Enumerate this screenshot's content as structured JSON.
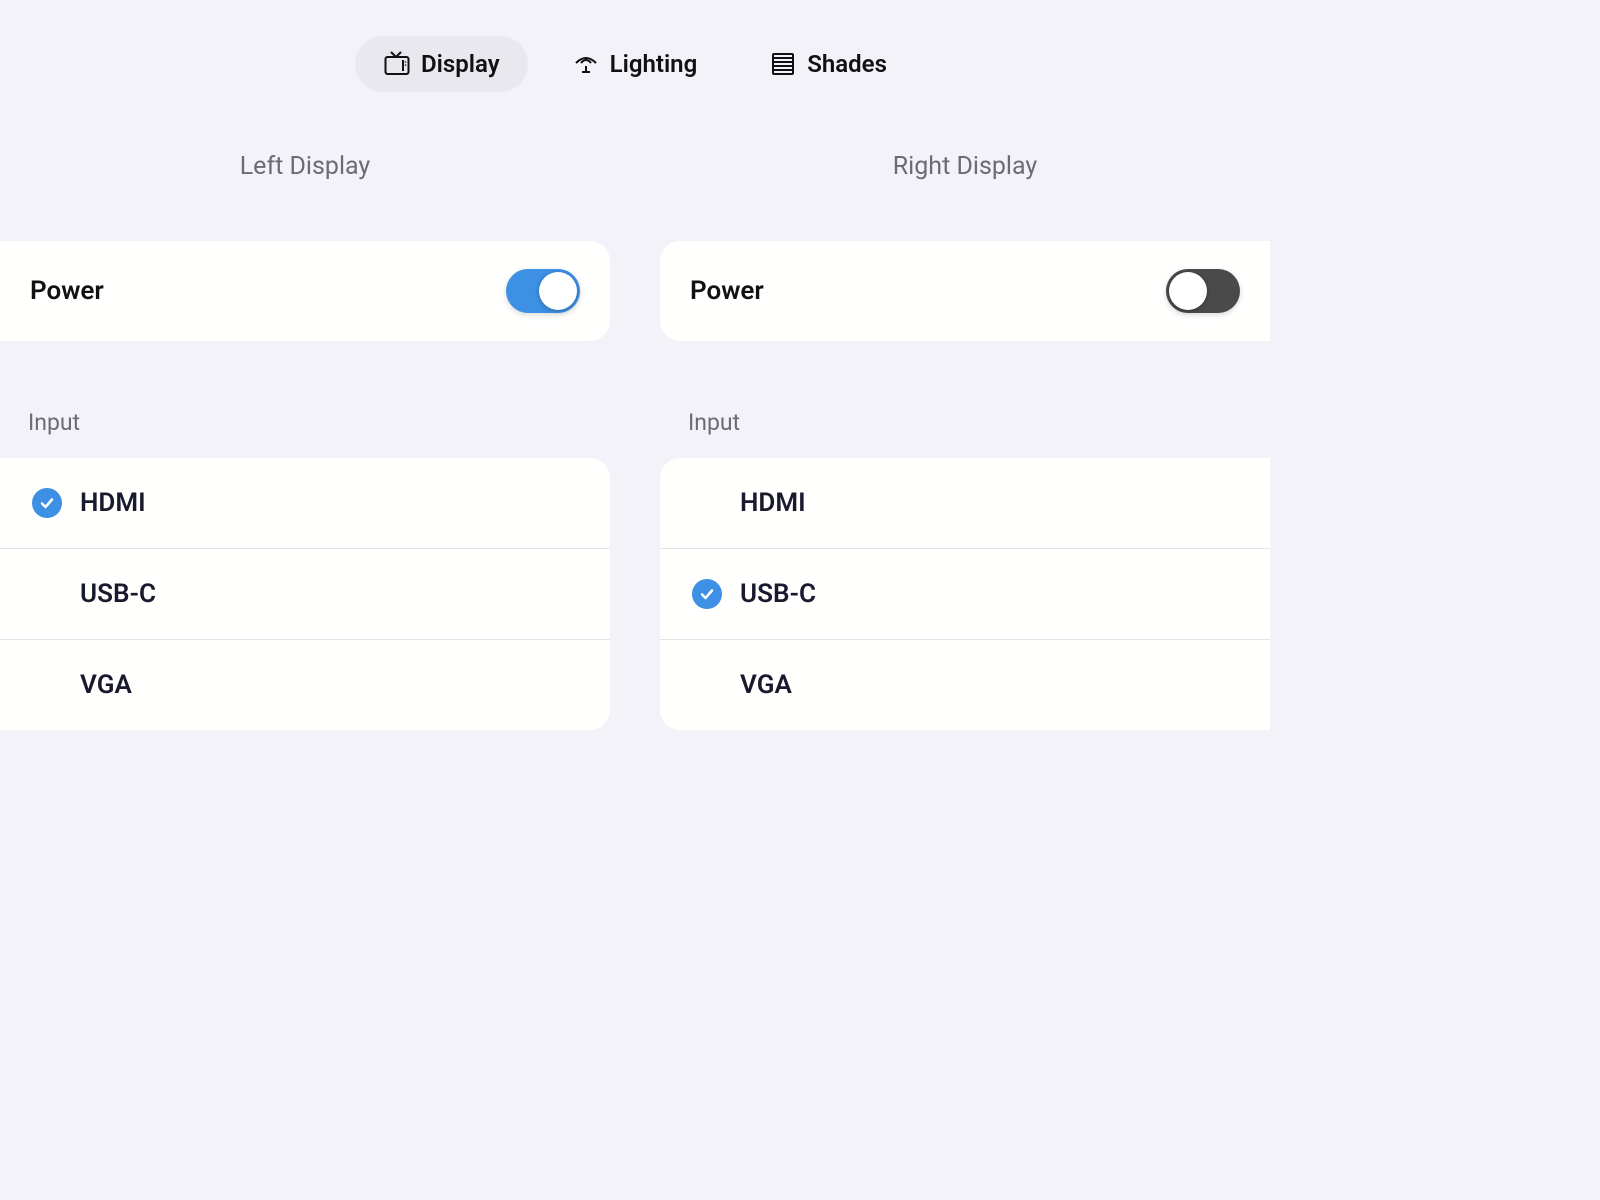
{
  "tabs": [
    {
      "label": "Display",
      "icon": "tv-icon",
      "active": true
    },
    {
      "label": "Lighting",
      "icon": "light-icon",
      "active": false
    },
    {
      "label": "Shades",
      "icon": "shades-icon",
      "active": false
    }
  ],
  "panels": {
    "left": {
      "title": "Left Display",
      "power_label": "Power",
      "power_on": true,
      "input_section_label": "Input",
      "inputs": [
        {
          "label": "HDMI",
          "selected": true
        },
        {
          "label": "USB-C",
          "selected": false
        },
        {
          "label": "VGA",
          "selected": false
        }
      ]
    },
    "right": {
      "title": "Right Display",
      "power_label": "Power",
      "power_on": false,
      "input_section_label": "Input",
      "inputs": [
        {
          "label": "HDMI",
          "selected": false
        },
        {
          "label": "USB-C",
          "selected": true
        },
        {
          "label": "VGA",
          "selected": false
        }
      ]
    }
  },
  "colors": {
    "background": "#f3f2f8",
    "card": "#fffffe",
    "accent": "#3d90e3",
    "toggle_off": "#4a4a4a",
    "text_primary": "#111",
    "text_secondary": "#6b6b72",
    "divider": "#e4e4e8",
    "tab_active_bg": "#e9e8ee"
  }
}
